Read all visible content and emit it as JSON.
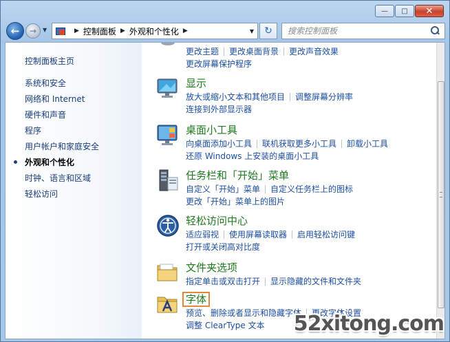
{
  "window": {
    "minimize": "—",
    "maximize": "□",
    "close": "✕"
  },
  "nav": {
    "breadcrumb": [
      "控制面板",
      "外观和个性化"
    ],
    "search_placeholder": "搜索控制面板"
  },
  "sidebar": {
    "home": "控制面板主页",
    "items": [
      {
        "label": "系统和安全"
      },
      {
        "label": "网络和 Internet"
      },
      {
        "label": "硬件和声音"
      },
      {
        "label": "程序"
      },
      {
        "label": "用户帐户和家庭安全"
      },
      {
        "label": "外观和个性化",
        "active": true
      },
      {
        "label": "时钟、语言和区域"
      },
      {
        "label": "轻松访问"
      }
    ]
  },
  "categories": {
    "personalization": {
      "links_row1": [
        "更改主题",
        "更改桌面背景",
        "更改声音效果"
      ],
      "links_row2": [
        "更改屏幕保护程序"
      ]
    },
    "display": {
      "title": "显示",
      "links_row1": [
        "放大或缩小文本和其他项目",
        "调整屏幕分辨率"
      ],
      "links_row2": [
        "连接到外部显示器"
      ]
    },
    "gadgets": {
      "title": "桌面小工具",
      "links_row1": [
        "向桌面添加小工具",
        "联机获取更多小工具",
        "卸载小工具"
      ],
      "links_row2": [
        "还原 Windows 上安装的桌面小工具"
      ]
    },
    "taskbar": {
      "title": "任务栏和「开始」菜单",
      "links_row1": [
        "自定义「开始」菜单",
        "自定义任务栏上的图标"
      ],
      "links_row2": [
        "更改「开始」菜单上的图片"
      ]
    },
    "ease": {
      "title": "轻松访问中心",
      "links_row1": [
        "适应弱视",
        "使用屏幕读取器",
        "启用轻松访问键"
      ],
      "links_row2": [
        "打开或关闭高对比度"
      ]
    },
    "folder": {
      "title": "文件夹选项",
      "links_row1": [
        "指定单击或双击打开",
        "显示隐藏的文件和文件夹"
      ]
    },
    "fonts": {
      "title": "字体",
      "links_row1": [
        "预览、删除或者显示和隐藏字体",
        "更改字体设置"
      ],
      "links_row2": [
        "调整 ClearType 文本"
      ]
    }
  },
  "watermark": "52xitong.com",
  "colors": {
    "link": "#1d4fa3",
    "category_title": "#1e7a1e",
    "highlight_border": "#e8863c"
  }
}
